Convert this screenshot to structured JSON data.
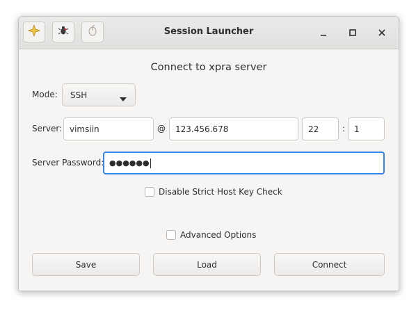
{
  "window": {
    "title": "Session Launcher",
    "toolbar_icons": [
      "sparkle-icon",
      "bug-icon",
      "mouse-icon"
    ],
    "controls": [
      "minimize-icon",
      "maximize-icon",
      "close-icon"
    ]
  },
  "heading": "Connect to xpra server",
  "mode": {
    "label": "Mode:",
    "value": "SSH"
  },
  "server": {
    "label": "Server:",
    "username": "vimsiin",
    "at": "@",
    "host": "123.456.678",
    "port": "22",
    "colon": ":",
    "display": "1"
  },
  "password": {
    "label": "Server Password:",
    "masked_value": "●●●●●●"
  },
  "strict_host": {
    "label": "Disable Strict Host Key Check",
    "checked": false
  },
  "advanced": {
    "label": "Advanced Options",
    "checked": false
  },
  "buttons": {
    "save": "Save",
    "load": "Load",
    "connect": "Connect"
  },
  "colors": {
    "focus": "#3584e4",
    "sparkle": "#f2c744"
  }
}
